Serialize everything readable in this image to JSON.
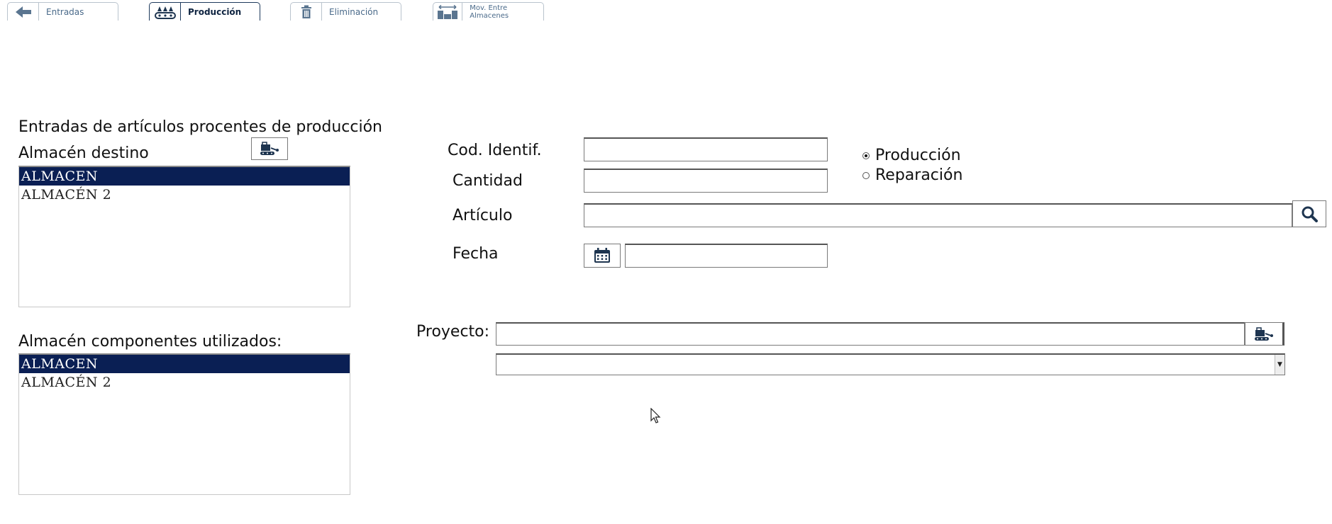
{
  "tabs": [
    {
      "label": "Entradas",
      "icon": "arrow-left-icon"
    },
    {
      "label": "Producción",
      "icon": "production-conveyor-icon",
      "active": true
    },
    {
      "label": "Eliminación",
      "icon": "trash-icon"
    },
    {
      "label": "Mov. Entre Almacenes",
      "icon": "transfer-icon"
    }
  ],
  "form": {
    "heading": "Entradas de artículos procentes de producción",
    "almacen_destino_label": "Almacén destino",
    "almacen_destino_items": [
      "ALMACEN",
      "ALMACÉN 2"
    ],
    "almacen_componentes_label": "Almacén componentes utilizados:",
    "almacen_componentes_items": [
      "ALMACEN",
      "ALMACÉN 2"
    ],
    "cod_identif_label": "Cod. Identif.",
    "cod_identif_value": "",
    "cantidad_label": "Cantidad",
    "cantidad_value": "",
    "articulo_label": "Artículo",
    "articulo_value": "",
    "fecha_label": "Fecha",
    "fecha_value": "",
    "tipo_options": [
      "Producción",
      "Reparación"
    ],
    "tipo_selected": "Producción",
    "proyecto_label": "Proyecto:",
    "proyecto_value": "",
    "proyecto_select_value": ""
  },
  "colors": {
    "selection": "#0a1f54",
    "tab_active": "#0e2340",
    "tab_inactive": "#4a6a8a",
    "icon_dark": "#1e3550"
  }
}
